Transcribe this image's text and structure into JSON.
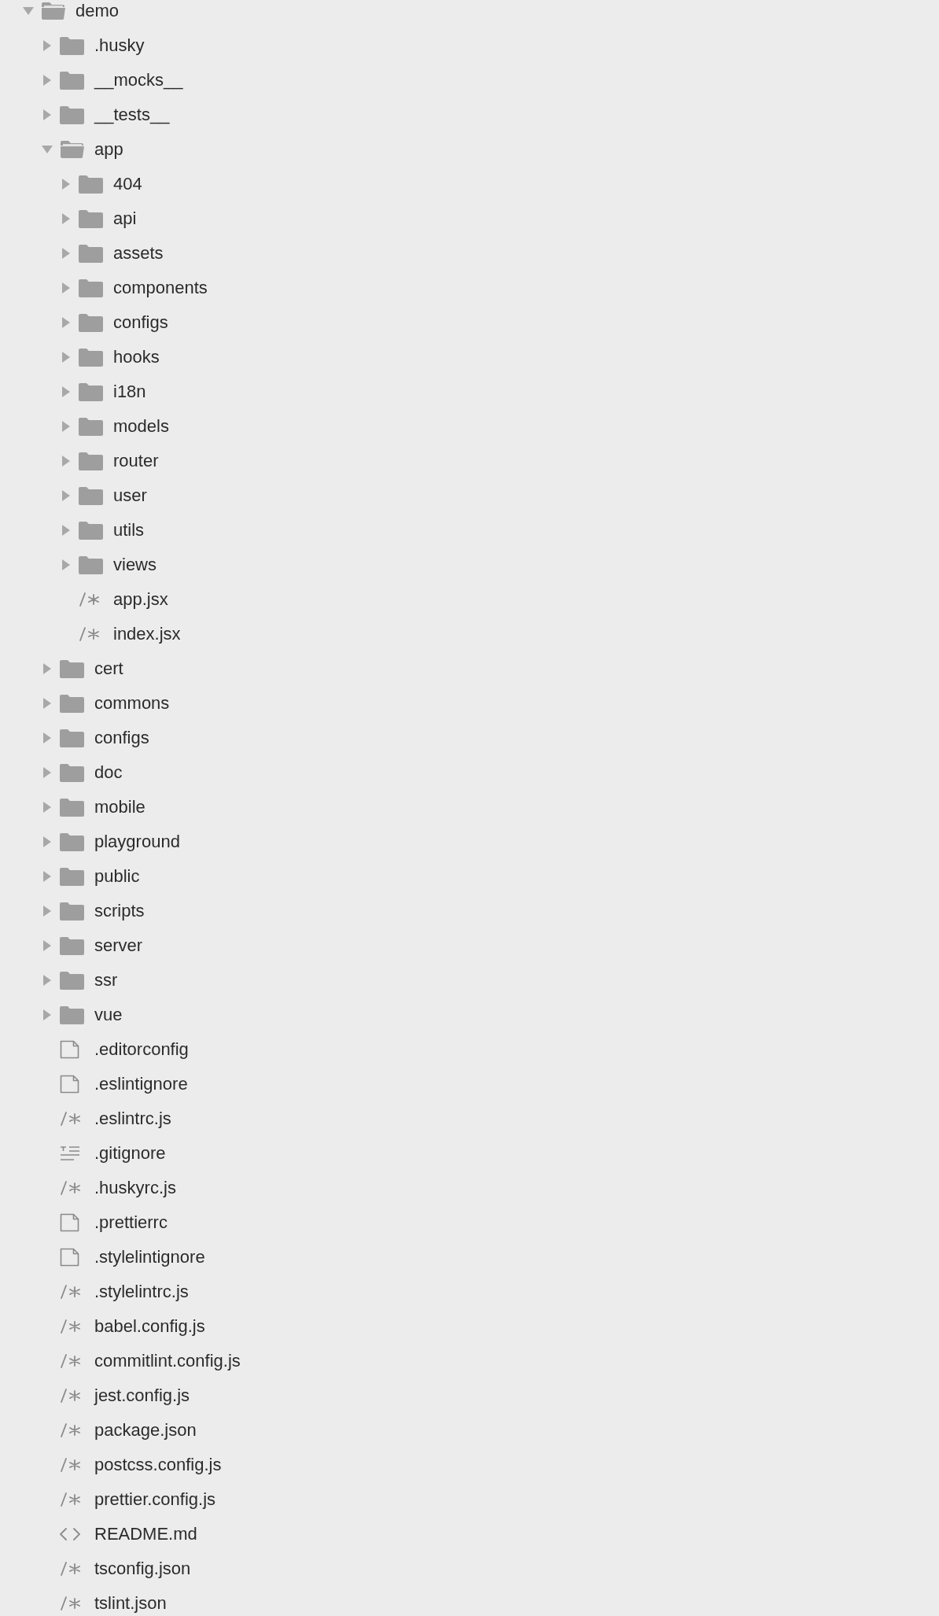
{
  "tree": [
    {
      "name": "demo",
      "kind": "folder",
      "expanded": true,
      "children": [
        {
          "name": ".husky",
          "kind": "folder",
          "expanded": false
        },
        {
          "name": "__mocks__",
          "kind": "folder",
          "expanded": false
        },
        {
          "name": "__tests__",
          "kind": "folder",
          "expanded": false
        },
        {
          "name": "app",
          "kind": "folder",
          "expanded": true,
          "children": [
            {
              "name": "404",
              "kind": "folder",
              "expanded": false
            },
            {
              "name": "api",
              "kind": "folder",
              "expanded": false
            },
            {
              "name": "assets",
              "kind": "folder",
              "expanded": false
            },
            {
              "name": "components",
              "kind": "folder",
              "expanded": false
            },
            {
              "name": "configs",
              "kind": "folder",
              "expanded": false
            },
            {
              "name": "hooks",
              "kind": "folder",
              "expanded": false
            },
            {
              "name": "i18n",
              "kind": "folder",
              "expanded": false
            },
            {
              "name": "models",
              "kind": "folder",
              "expanded": false
            },
            {
              "name": "router",
              "kind": "folder",
              "expanded": false
            },
            {
              "name": "user",
              "kind": "folder",
              "expanded": false
            },
            {
              "name": "utils",
              "kind": "folder",
              "expanded": false
            },
            {
              "name": "views",
              "kind": "folder",
              "expanded": false
            },
            {
              "name": "app.jsx",
              "kind": "code"
            },
            {
              "name": "index.jsx",
              "kind": "code"
            }
          ]
        },
        {
          "name": "cert",
          "kind": "folder",
          "expanded": false
        },
        {
          "name": "commons",
          "kind": "folder",
          "expanded": false
        },
        {
          "name": "configs",
          "kind": "folder",
          "expanded": false
        },
        {
          "name": "doc",
          "kind": "folder",
          "expanded": false
        },
        {
          "name": "mobile",
          "kind": "folder",
          "expanded": false
        },
        {
          "name": "playground",
          "kind": "folder",
          "expanded": false
        },
        {
          "name": "public",
          "kind": "folder",
          "expanded": false
        },
        {
          "name": "scripts",
          "kind": "folder",
          "expanded": false
        },
        {
          "name": "server",
          "kind": "folder",
          "expanded": false
        },
        {
          "name": "ssr",
          "kind": "folder",
          "expanded": false
        },
        {
          "name": "vue",
          "kind": "folder",
          "expanded": false
        },
        {
          "name": ".editorconfig",
          "kind": "file"
        },
        {
          "name": ".eslintignore",
          "kind": "file"
        },
        {
          "name": ".eslintrc.js",
          "kind": "code"
        },
        {
          "name": ".gitignore",
          "kind": "text"
        },
        {
          "name": ".huskyrc.js",
          "kind": "code"
        },
        {
          "name": ".prettierrc",
          "kind": "file"
        },
        {
          "name": ".stylelintignore",
          "kind": "file"
        },
        {
          "name": ".stylelintrc.js",
          "kind": "code"
        },
        {
          "name": "babel.config.js",
          "kind": "code"
        },
        {
          "name": "commitlint.config.js",
          "kind": "code"
        },
        {
          "name": "jest.config.js",
          "kind": "code"
        },
        {
          "name": "package.json",
          "kind": "code"
        },
        {
          "name": "postcss.config.js",
          "kind": "code"
        },
        {
          "name": "prettier.config.js",
          "kind": "code"
        },
        {
          "name": "README.md",
          "kind": "markup"
        },
        {
          "name": "tsconfig.json",
          "kind": "code"
        },
        {
          "name": "tslint.json",
          "kind": "code"
        }
      ]
    }
  ]
}
